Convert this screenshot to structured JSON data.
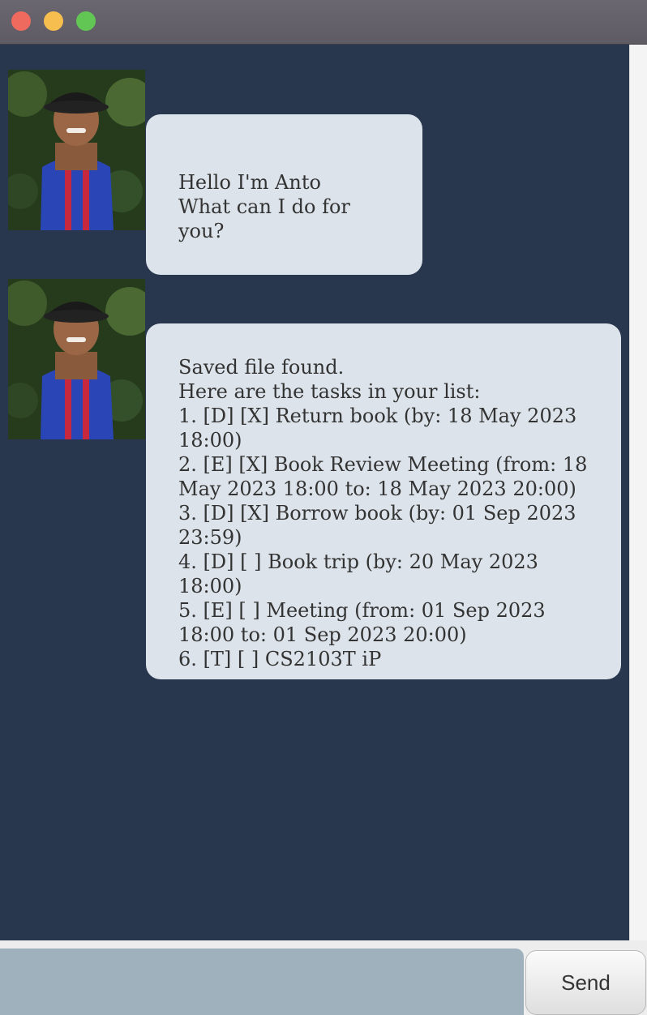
{
  "window": {
    "traffic_lights": [
      {
        "name": "close",
        "color": "#ee6a5f"
      },
      {
        "name": "minimize",
        "color": "#f5be4f"
      },
      {
        "name": "maximize",
        "color": "#62c655"
      }
    ]
  },
  "chat": {
    "background_color": "#29374e",
    "bubble_color": "#dce3ea",
    "messages": [
      {
        "sender": "bot",
        "avatar_icon": "user-photo",
        "lines": [
          "Hello I'm Anto",
          "What can I do for you?"
        ]
      },
      {
        "sender": "bot",
        "avatar_icon": "user-photo",
        "lines": [
          "Saved file found.",
          "Here are the tasks in your list:",
          "1. [D] [X] Return book (by: 18 May 2023 18:00)",
          "2. [E] [X] Book Review Meeting (from: 18 May 2023 18:00 to: 18 May 2023 20:00)",
          "3. [D] [X] Borrow book (by: 01 Sep 2023 23:59)",
          "4. [D] [ ] Book trip (by: 20 May 2023 18:00)",
          "5. [E] [ ] Meeting (from: 01 Sep 2023 18:00 to: 01 Sep 2023 20:00)",
          "6. [T] [ ] CS2103T iP"
        ]
      }
    ]
  },
  "input": {
    "value": "",
    "placeholder": ""
  },
  "send_button": {
    "label": "Send"
  }
}
